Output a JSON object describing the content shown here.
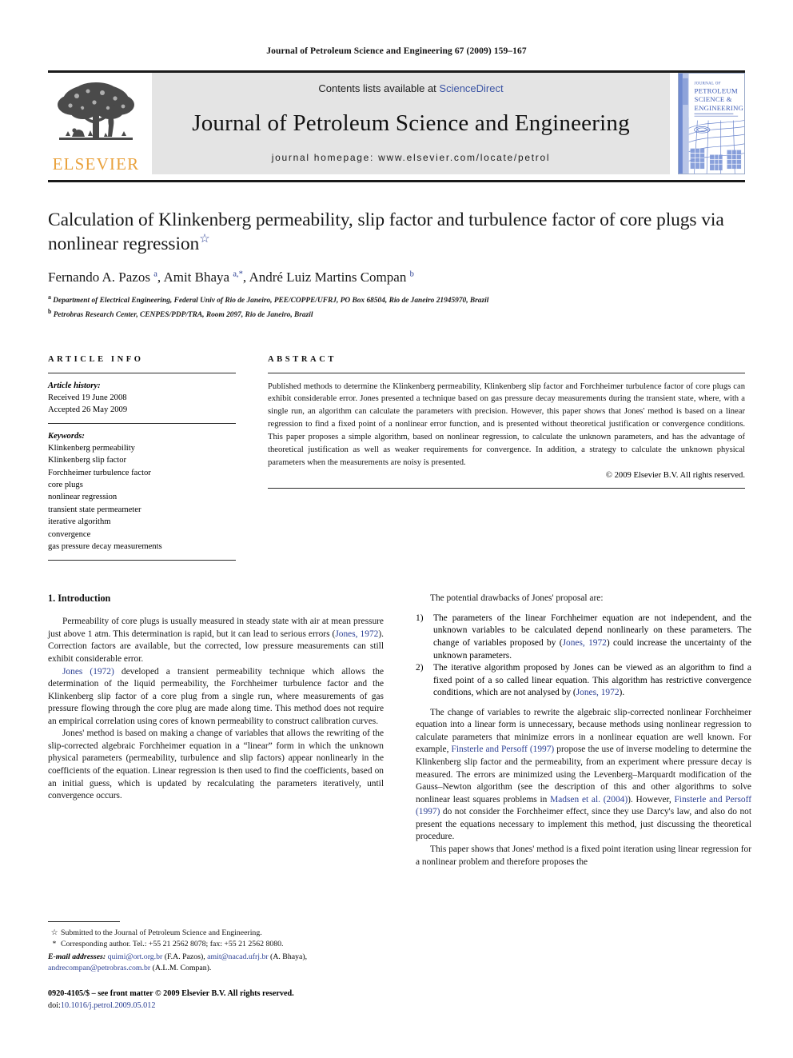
{
  "running_head": "Journal of Petroleum Science and Engineering 67 (2009) 159–167",
  "masthead": {
    "publisher_wordmark": "ELSEVIER",
    "contents_prefix": "Contents lists available at ",
    "sciencedirect": "ScienceDirect",
    "journal_title": "Journal of Petroleum Science and Engineering",
    "homepage": "journal homepage: www.elsevier.com/locate/petrol",
    "cover": {
      "line1": "JOURNAL OF",
      "line2": "PETROLEUM",
      "line3": "SCIENCE &",
      "line4": "ENGINEERING",
      "accent": "#3d5bb5"
    }
  },
  "article": {
    "title": "Calculation of Klinkenberg permeability, slip factor and turbulence factor of core plugs via nonlinear regression",
    "title_footnote_mark": "☆",
    "authors_html": "Fernando A. Pazos <sup>a</sup>, Amit Bhaya <sup>a,</sup><sup>*</sup>, André Luiz Martins Compan <sup>b</sup>",
    "affiliations": [
      {
        "mark": "a",
        "text": "Department of Electrical Engineering, Federal Univ of Rio de Janeiro, PEE/COPPE/UFRJ, PO Box 68504, Rio de Janeiro 21945970, Brazil"
      },
      {
        "mark": "b",
        "text": "Petrobras Research Center, CENPES/PDP/TRA, Room 2097, Rio de Janeiro, Brazil"
      }
    ]
  },
  "info": {
    "heading": "ARTICLE INFO",
    "history_label": "Article history:",
    "history": [
      "Received 19 June 2008",
      "Accepted 26 May 2009"
    ],
    "keywords_label": "Keywords:",
    "keywords": [
      "Klinkenberg permeability",
      "Klinkenberg slip factor",
      "Forchheimer turbulence factor",
      "core plugs",
      "nonlinear regression",
      "transient state permeameter",
      "iterative algorithm",
      "convergence",
      "gas pressure decay measurements"
    ]
  },
  "abstract": {
    "heading": "ABSTRACT",
    "text": "Published methods to determine the Klinkenberg permeability, Klinkenberg slip factor and Forchheimer turbulence factor of core plugs can exhibit considerable error. Jones presented a technique based on gas pressure decay measurements during the transient state, where, with a single run, an algorithm can calculate the parameters with precision. However, this paper shows that Jones' method is based on a linear regression to find a fixed point of a nonlinear error function, and is presented without theoretical justification or convergence conditions. This paper proposes a simple algorithm, based on nonlinear regression, to calculate the unknown parameters, and has the advantage of theoretical justification as well as weaker requirements for convergence. In addition, a strategy to calculate the unknown physical parameters when the measurements are noisy is presented.",
    "copyright": "© 2009 Elsevier B.V. All rights reserved."
  },
  "body": {
    "section_heading": "1. Introduction",
    "left_paragraphs": [
      "Permeability of core plugs is usually measured in steady state with air at mean pressure just above 1 atm. This determination is rapid, but it can lead to serious errors (<a class=\"cite\" data-name=\"citation-link\" data-interactable=\"true\" href=\"#\">Jones, 1972</a>). Correction factors are available, but the corrected, low pressure measurements can still exhibit considerable error.",
      "<a class=\"cite\" data-name=\"citation-link\" data-interactable=\"true\" href=\"#\">Jones (1972)</a> developed a transient permeability technique which allows the determination of the liquid permeability, the Forchheimer turbulence factor and the Klinkenberg slip factor of a core plug from a single run, where measurements of gas pressure flowing through the core plug are made along time. This method does not require an empirical correlation using cores of known permeability to construct calibration curves.",
      "Jones' method is based on making a change of variables that allows the rewriting of the slip-corrected algebraic Forchheimer equation in a “linear” form in which the unknown physical parameters (permeability, turbulence and slip factors) appear nonlinearly in the coefficients of the equation. Linear regression is then used to find the coefficients, based on an initial guess, which is updated by recalculating the parameters iteratively, until convergence occurs."
    ],
    "right_intro": "The potential drawbacks of Jones' proposal are:",
    "drawbacks": [
      {
        "num": "1)",
        "text": "The parameters of the linear Forchheimer equation are not independent, and the unknown variables to be calculated depend nonlinearly on these parameters. The change of variables proposed by (<a class=\"cite\" data-name=\"citation-link\" data-interactable=\"true\" href=\"#\">Jones, 1972</a>) could increase the uncertainty of the unknown parameters."
      },
      {
        "num": "2)",
        "text": "The iterative algorithm proposed by Jones can be viewed as an algorithm to find a fixed point of a so called linear equation. This algorithm has restrictive convergence conditions, which are not analysed by (<a class=\"cite\" data-name=\"citation-link\" data-interactable=\"true\" href=\"#\">Jones, 1972</a>)."
      }
    ],
    "right_paragraphs": [
      "The change of variables to rewrite the algebraic slip-corrected nonlinear Forchheimer equation into a linear form is unnecessary, because methods using nonlinear regression to calculate parameters that minimize errors in a nonlinear equation are well known. For example, <a class=\"cite\" data-name=\"citation-link\" data-interactable=\"true\" href=\"#\">Finsterle and Persoff (1997)</a> propose the use of inverse modeling to determine the Klinkenberg slip factor and the permeability, from an experiment where pressure decay is measured. The errors are minimized using the Levenberg–Marquardt modification of the Gauss–Newton algorithm (see the description of this and other algorithms to solve nonlinear least squares problems in <a class=\"cite\" data-name=\"citation-link\" data-interactable=\"true\" href=\"#\">Madsen et al. (2004)</a>). However, <a class=\"cite\" data-name=\"citation-link\" data-interactable=\"true\" href=\"#\">Finsterle and Persoff (1997)</a> do not consider the Forchheimer effect, since they use Darcy's law, and also do not present the equations necessary to implement this method, just discussing the theoretical procedure.",
      "This paper shows that Jones' method is a fixed point iteration using linear regression for a nonlinear problem and therefore proposes the"
    ]
  },
  "footnotes": {
    "title_note_mark": "☆",
    "title_note": "Submitted to the Journal of Petroleum Science and Engineering.",
    "corresponding_mark": "*",
    "corresponding": "Corresponding author. Tel.: +55 21 2562 8078; fax: +55 21 2562 8080.",
    "email_label": "E-mail addresses:",
    "emails_html": "<a class=\"cite\" data-name=\"email-link\" data-interactable=\"true\" href=\"#\">quimi@ort.org.br</a> (F.A. Pazos), <a class=\"cite\" data-name=\"email-link\" data-interactable=\"true\" href=\"#\">amit@nacad.ufrj.br</a> (A. Bhaya), <a class=\"cite\" data-name=\"email-link\" data-interactable=\"true\" href=\"#\">andrecompan@petrobras.com.br</a> (A.L.M. Compan).",
    "issn_line": "0920-4105/$ – see front matter © 2009 Elsevier B.V. All rights reserved.",
    "doi_label": "doi:",
    "doi_value": "10.1016/j.petrol.2009.05.012"
  },
  "colors": {
    "link_blue": "#2b3f93",
    "elsevier_orange": "#E9A13B",
    "banner_gray": "#e4e4e4"
  }
}
